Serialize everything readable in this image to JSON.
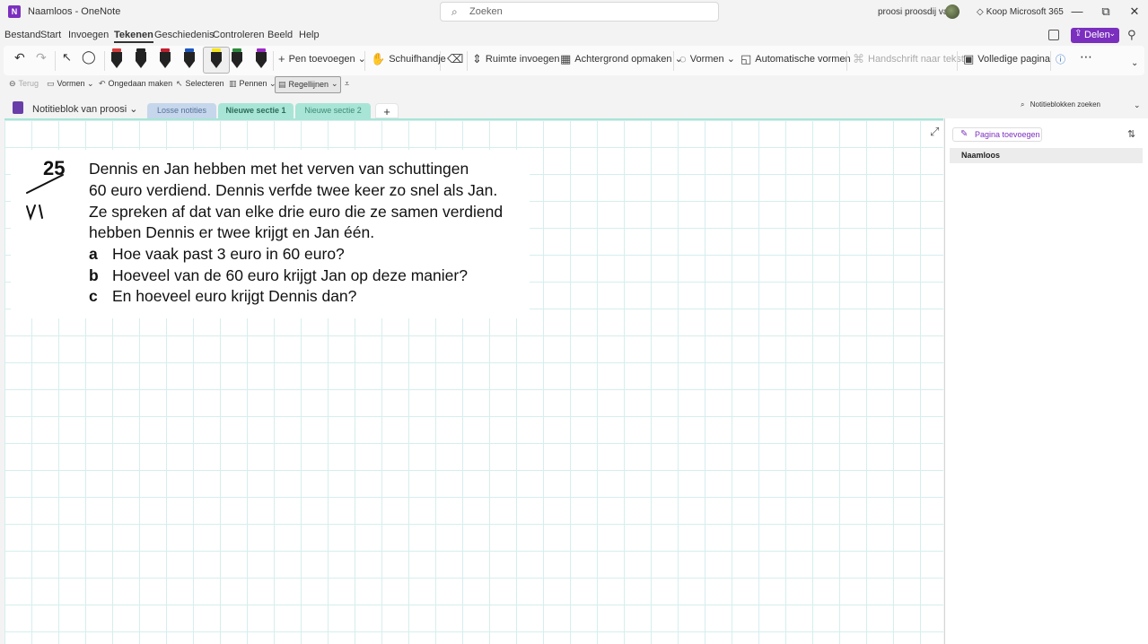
{
  "titlebar": {
    "app_icon": "onenote-icon",
    "title": "Naamloos - OneNote",
    "search_placeholder": "Zoeken",
    "user": "proosi proosdij van",
    "buy": "Koop Microsoft 365",
    "minimize": "—",
    "restore": "⧉",
    "close": "✕"
  },
  "menu": {
    "items": [
      "Bestand",
      "Start",
      "Invoegen",
      "Tekenen",
      "Geschiedenis",
      "Controleren",
      "Beeld",
      "Help"
    ],
    "active": "Tekenen",
    "share": "Delen"
  },
  "ribbon": {
    "add_pen": "Pen toevoegen",
    "hand": "Schuifhandje",
    "insert_space": "Ruimte invoegen",
    "background": "Achtergrond opmaken",
    "shapes": "Vormen",
    "auto_shapes": "Automatische vormen",
    "ink_to_text": "Handschrift naar tekst",
    "full_page": "Volledige pagina",
    "pens": [
      {
        "cap": "#d63c3c",
        "body": "#222222"
      },
      {
        "cap": "#222222",
        "body": "#222222"
      },
      {
        "cap": "#c01f2f",
        "body": "#222222"
      },
      {
        "cap": "#1f57c0",
        "body": "#222222"
      },
      {
        "cap": "#f5e419",
        "body": "#222222"
      },
      {
        "cap": "#2d8a3c",
        "body": "#222222"
      },
      {
        "cap": "#9b2bc6",
        "body": "#222222"
      }
    ]
  },
  "toolbar2": {
    "back": "Terug",
    "shapes": "Vormen",
    "undo": "Ongedaan maken",
    "select": "Selecteren",
    "pens": "Pennen",
    "ruled": "Regellijnen"
  },
  "notebook": {
    "name": "Notitieblok van proosi",
    "sections": [
      "Losse notities",
      "Nieuwe sectie 1",
      "Nieuwe sectie 2"
    ],
    "add_section": "+",
    "search": "Notitieblokken zoeken"
  },
  "exercise": {
    "number": "25",
    "lines": [
      "Dennis en Jan hebben met het verven van schuttingen",
      "60 euro verdiend. Dennis verfde twee keer zo snel als Jan.",
      "Ze spreken af dat van elke drie euro die ze samen verdiend",
      "hebben Dennis er twee krijgt en Jan één."
    ],
    "questions": [
      {
        "letter": "a",
        "text": "Hoe vaak past 3 euro in 60 euro?"
      },
      {
        "letter": "b",
        "text": "Hoeveel van de 60 euro krijgt Jan op deze manier?"
      },
      {
        "letter": "c",
        "text": "En hoeveel euro krijgt Dennis dan?"
      }
    ]
  },
  "pages": {
    "add": "Pagina toevoegen",
    "items": [
      "Naamloos"
    ]
  }
}
